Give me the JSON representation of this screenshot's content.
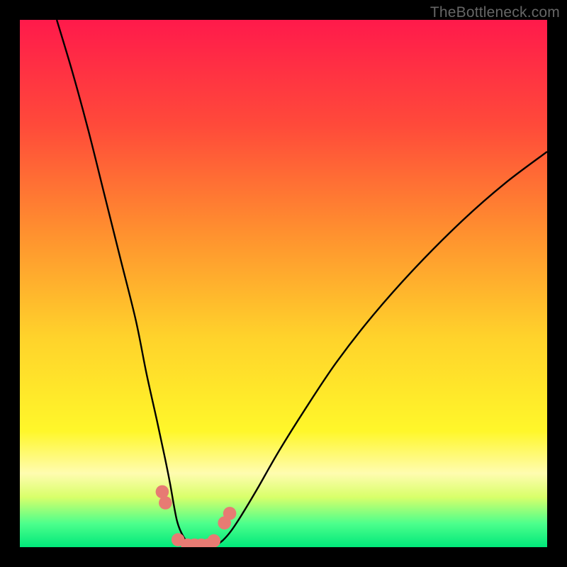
{
  "watermark": "TheBottleneck.com",
  "chart_data": {
    "type": "line",
    "title": "",
    "xlabel": "",
    "ylabel": "",
    "xlim": [
      0,
      100
    ],
    "ylim": [
      0,
      100
    ],
    "background_gradient": {
      "stops": [
        {
          "offset": 0.0,
          "color": "#ff1a4b"
        },
        {
          "offset": 0.2,
          "color": "#ff4a3a"
        },
        {
          "offset": 0.4,
          "color": "#ff8f2f"
        },
        {
          "offset": 0.6,
          "color": "#ffd22b"
        },
        {
          "offset": 0.78,
          "color": "#fff72a"
        },
        {
          "offset": 0.86,
          "color": "#fffcb0"
        },
        {
          "offset": 0.905,
          "color": "#d9ff6a"
        },
        {
          "offset": 0.955,
          "color": "#4dff8c"
        },
        {
          "offset": 1.0,
          "color": "#00e87a"
        }
      ]
    },
    "series": [
      {
        "name": "left-branch",
        "x": [
          7,
          10,
          13,
          16,
          19,
          22,
          24,
          26,
          27.5,
          28.5,
          29.2,
          29.8,
          30.5,
          31.5,
          33
        ],
        "y": [
          100,
          90,
          79,
          67,
          55,
          43,
          33,
          24,
          17,
          12,
          8,
          5,
          3,
          1.3,
          0.2
        ]
      },
      {
        "name": "right-branch",
        "x": [
          37,
          38.5,
          40,
          42,
          45,
          49,
          54,
          60,
          67,
          75,
          84,
          92,
          100
        ],
        "y": [
          0.2,
          1.3,
          3,
          6,
          11,
          18,
          26,
          35,
          44,
          53,
          62,
          69,
          75
        ]
      }
    ],
    "floor_markers": {
      "description": "salmon dot segments along the valley floor",
      "segments": [
        {
          "x0": 27.0,
          "x1": 27.6,
          "y": 10.5
        },
        {
          "x0": 27.6,
          "x1": 28.3,
          "y": 8.4
        },
        {
          "x0": 30.0,
          "x1": 31.0,
          "y": 1.4
        },
        {
          "x0": 31.8,
          "x1": 36.2,
          "y": 0.4
        },
        {
          "x0": 36.8,
          "x1": 37.6,
          "y": 1.2
        },
        {
          "x0": 38.8,
          "x1": 39.6,
          "y": 4.6
        },
        {
          "x0": 39.8,
          "x1": 40.6,
          "y": 6.4
        }
      ],
      "color": "#e77b73",
      "radius": 1.25
    }
  }
}
